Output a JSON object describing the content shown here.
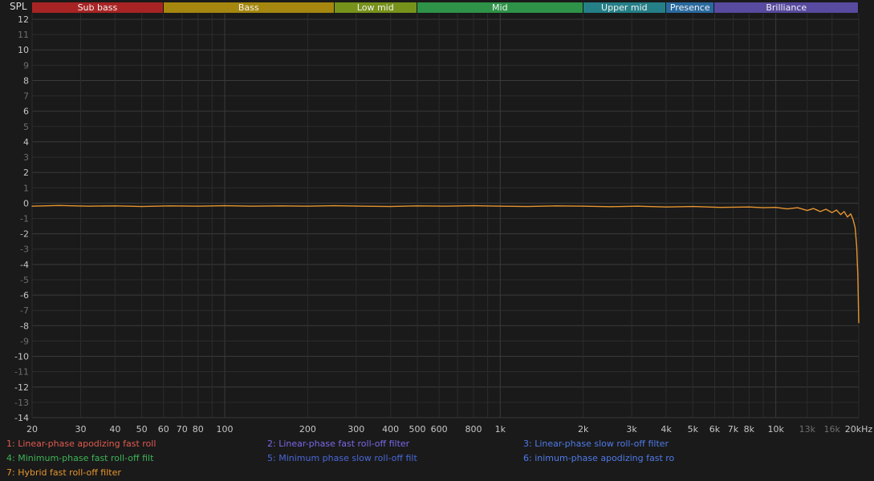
{
  "window": {
    "axis_title": "SPL"
  },
  "colors": {
    "background": "#1a1a1a",
    "grid_minor": "#2c2c2c",
    "grid_major": "#3a3a3a",
    "zero_line": "#3e3e3e",
    "tick_bright": "#c6c6c6",
    "tick_dim": "#6e6e6e",
    "trace": "#e6952f"
  },
  "bands": [
    {
      "label": "Sub bass",
      "f_start": 20,
      "f_end": 60,
      "color": "#a82424"
    },
    {
      "label": "Bass",
      "f_start": 60,
      "f_end": 250,
      "color": "#a5870f"
    },
    {
      "label": "Low mid",
      "f_start": 250,
      "f_end": 500,
      "color": "#77921b"
    },
    {
      "label": "Mid",
      "f_start": 500,
      "f_end": 2000,
      "color": "#2e9348"
    },
    {
      "label": "Upper mid",
      "f_start": 2000,
      "f_end": 4000,
      "color": "#257f87"
    },
    {
      "label": "Presence",
      "f_start": 4000,
      "f_end": 6000,
      "color": "#2a6a9e"
    },
    {
      "label": "Brilliance",
      "f_start": 6000,
      "f_end": 20000,
      "color": "#584a9e"
    }
  ],
  "chart_data": {
    "type": "line",
    "title": "",
    "ylabel": "SPL",
    "xlabel": "",
    "x_scale": "log",
    "xlim": [
      20,
      20000
    ],
    "ylim": [
      -14,
      12
    ],
    "y_tick_step": 1,
    "grid": true,
    "legend_position": "bottom",
    "y_ticks": [
      12,
      11,
      10,
      9,
      8,
      7,
      6,
      5,
      4,
      3,
      2,
      1,
      0,
      -1,
      -2,
      -3,
      -4,
      -5,
      -6,
      -7,
      -8,
      -9,
      -10,
      -11,
      -12,
      -13,
      -14
    ],
    "x_gridlines": [
      20,
      30,
      40,
      50,
      60,
      70,
      80,
      90,
      100,
      200,
      300,
      400,
      500,
      600,
      700,
      800,
      900,
      1000,
      2000,
      3000,
      4000,
      5000,
      6000,
      7000,
      8000,
      9000,
      10000,
      13000,
      16000,
      20000
    ],
    "x_tick_labels": [
      {
        "f": 20,
        "label": "20"
      },
      {
        "f": 30,
        "label": "30"
      },
      {
        "f": 40,
        "label": "40"
      },
      {
        "f": 50,
        "label": "50"
      },
      {
        "f": 60,
        "label": "60"
      },
      {
        "f": 70,
        "label": "70"
      },
      {
        "f": 80,
        "label": "80"
      },
      {
        "f": 100,
        "label": "100"
      },
      {
        "f": 200,
        "label": "200"
      },
      {
        "f": 300,
        "label": "300"
      },
      {
        "f": 400,
        "label": "400"
      },
      {
        "f": 500,
        "label": "500"
      },
      {
        "f": 600,
        "label": "600"
      },
      {
        "f": 800,
        "label": "800"
      },
      {
        "f": 1000,
        "label": "1k"
      },
      {
        "f": 2000,
        "label": "2k"
      },
      {
        "f": 3000,
        "label": "3k"
      },
      {
        "f": 4000,
        "label": "4k"
      },
      {
        "f": 5000,
        "label": "5k"
      },
      {
        "f": 6000,
        "label": "6k"
      },
      {
        "f": 7000,
        "label": "7k"
      },
      {
        "f": 8000,
        "label": "8k"
      },
      {
        "f": 10000,
        "label": "10k"
      },
      {
        "f": 13000,
        "label": "13k",
        "dim": true
      },
      {
        "f": 16000,
        "label": "16k",
        "dim": true
      },
      {
        "f": 20000,
        "label": "20kHz"
      }
    ],
    "series": [
      {
        "name": "1: Linear-phase apodizing fast roll",
        "color": "#e25a50",
        "note": "overlapped at 0 dB"
      },
      {
        "name": "2: Linear-phase fast roll-off filter",
        "color": "#7a68e8",
        "note": "overlapped at 0 dB"
      },
      {
        "name": "3: Linear-phase slow roll-off filter",
        "color": "#4f7ae8",
        "note": "overlapped at 0 dB"
      },
      {
        "name": "4: Minimum-phase fast roll-off filt",
        "color": "#3eb356",
        "note": "overlapped at 0 dB"
      },
      {
        "name": "5: Minimum phase slow roll-off filt",
        "color": "#4868d8",
        "note": "overlapped at 0 dB"
      },
      {
        "name": "6: inimum-phase apodizing fast ro",
        "color": "#4f7ae8",
        "note": "overlapped at 0 dB"
      },
      {
        "name": "7: Hybrid fast roll-off filter",
        "color": "#e6952f",
        "note": "visible top trace"
      }
    ],
    "visible_trace": {
      "name": "7: Hybrid fast roll-off filter",
      "color": "#e6952f",
      "points": [
        [
          20,
          -0.2
        ],
        [
          25,
          -0.15
        ],
        [
          32,
          -0.2
        ],
        [
          40,
          -0.18
        ],
        [
          50,
          -0.22
        ],
        [
          63,
          -0.18
        ],
        [
          80,
          -0.2
        ],
        [
          100,
          -0.17
        ],
        [
          125,
          -0.2
        ],
        [
          160,
          -0.18
        ],
        [
          200,
          -0.2
        ],
        [
          250,
          -0.17
        ],
        [
          315,
          -0.2
        ],
        [
          400,
          -0.22
        ],
        [
          500,
          -0.18
        ],
        [
          630,
          -0.2
        ],
        [
          800,
          -0.17
        ],
        [
          1000,
          -0.2
        ],
        [
          1250,
          -0.22
        ],
        [
          1600,
          -0.18
        ],
        [
          2000,
          -0.2
        ],
        [
          2500,
          -0.23
        ],
        [
          3150,
          -0.2
        ],
        [
          4000,
          -0.25
        ],
        [
          5000,
          -0.22
        ],
        [
          6300,
          -0.28
        ],
        [
          8000,
          -0.25
        ],
        [
          9000,
          -0.3
        ],
        [
          10000,
          -0.28
        ],
        [
          11000,
          -0.38
        ],
        [
          12000,
          -0.3
        ],
        [
          13000,
          -0.48
        ],
        [
          13700,
          -0.35
        ],
        [
          14500,
          -0.55
        ],
        [
          15200,
          -0.4
        ],
        [
          16000,
          -0.62
        ],
        [
          16600,
          -0.45
        ],
        [
          17200,
          -0.75
        ],
        [
          17700,
          -0.55
        ],
        [
          18200,
          -0.9
        ],
        [
          18700,
          -0.7
        ],
        [
          19100,
          -1.1
        ],
        [
          19400,
          -1.6
        ],
        [
          19650,
          -2.8
        ],
        [
          19850,
          -4.8
        ],
        [
          20000,
          -7.8
        ]
      ]
    }
  },
  "legend": {
    "items": [
      {
        "label": "1: Linear-phase apodizing fast roll",
        "color": "#e25a50"
      },
      {
        "label": "2: Linear-phase fast roll-off filter",
        "color": "#7a68e8"
      },
      {
        "label": "3: Linear-phase slow roll-off filter",
        "color": "#4f7ae8"
      },
      {
        "label": "4: Minimum-phase fast roll-off filt",
        "color": "#3eb356"
      },
      {
        "label": "5: Minimum phase slow roll-off filt",
        "color": "#4868d8"
      },
      {
        "label": "6: inimum-phase apodizing fast ro",
        "color": "#4f7ae8"
      },
      {
        "label": "7: Hybrid fast roll-off filter",
        "color": "#e6952f"
      }
    ]
  }
}
